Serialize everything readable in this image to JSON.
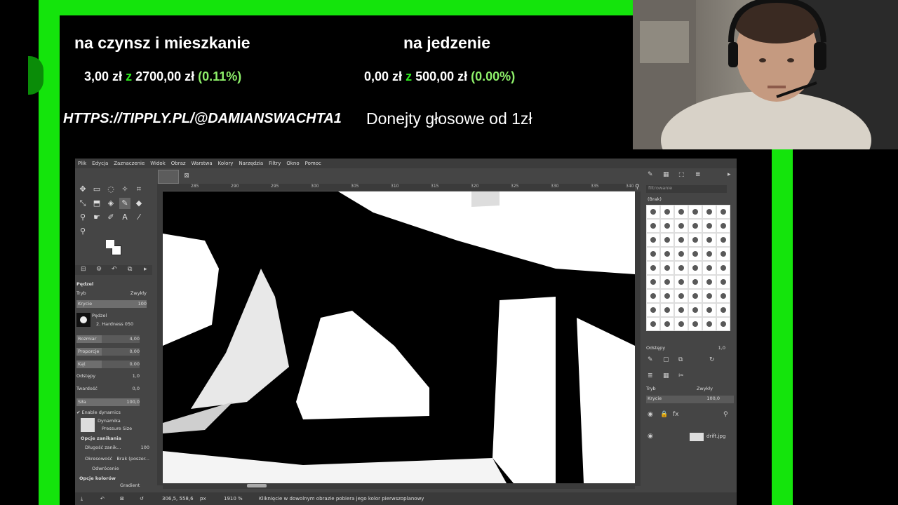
{
  "stream": {
    "goals": [
      {
        "title": "na czynsz i mieszkanie",
        "current": "3,00 zł",
        "sep": "z",
        "target": "2700,00 zł",
        "pct": "(0.11%)"
      },
      {
        "title": "na jedzenie",
        "current": "0,00 zł",
        "sep": "z",
        "target": "500,00 zł",
        "pct": "(0.00%)"
      }
    ],
    "tippy_url": "HTTPS://TIPPLY.PL/@DAMIANSWACHTA1",
    "donate_text": "Donejty głosowe od 1zł",
    "colors": {
      "frame_green": "#14e40c",
      "goal_accent": "#2ee81e",
      "pct_green": "#8ef06a"
    }
  },
  "gimp": {
    "menu": [
      "Plik",
      "Edycja",
      "Zaznaczenie",
      "Widok",
      "Obraz",
      "Warstwa",
      "Kolory",
      "Narzędzia",
      "Filtry",
      "Okno",
      "Pomoc"
    ],
    "ruler_ticks": [
      "285",
      "290",
      "295",
      "300",
      "305",
      "310",
      "315",
      "320",
      "325",
      "330",
      "335",
      "340"
    ],
    "tool_options": {
      "title": "Pędzel",
      "mode_label": "Tryb",
      "mode_value": "Zwykły",
      "opacity_label": "Krycie",
      "opacity_value": "100",
      "brush_label": "Pędzel",
      "brush_value": "2. Hardness 050",
      "size_label": "Rozmiar",
      "size_value": "4,00",
      "aspect_label": "Proporcje",
      "aspect_value": "0,00",
      "angle_label": "Kąt",
      "angle_value": "0,00",
      "spacing_label": "Odstępy",
      "spacing_value": "1,0",
      "hardness_label": "Twardość",
      "hardness_value": "0,0",
      "force_label": "Siła",
      "force_value": "100,0",
      "dynamics_checkbox": "Enable dynamics",
      "dynamics_label": "Dynamika",
      "dynamics_value": "Pressure Size",
      "fade_section": "Opcje zanikania",
      "fade_length_label": "Długość zanik...",
      "fade_length_value": "100",
      "repeat_label": "Okresowość",
      "repeat_value": "Brak (poszer...",
      "reverse_label": "Odwrócenie",
      "color_section": "Opcje kolorów",
      "gradient_label": "Gradient"
    },
    "right_panel": {
      "filter_placeholder": "filtrowanie",
      "brush_set": "(Brak)",
      "spacing_label": "Odstępy",
      "spacing_value": "1,0",
      "layer_mode_label": "Tryb",
      "layer_mode_value": "Zwykły",
      "layer_opacity_label": "Krycie",
      "layer_opacity_value": "100,0",
      "layer_name": "drift.jpg"
    },
    "status": {
      "coords": "306,5, 558,6",
      "unit": "px",
      "zoom": "1910 %",
      "message": "Kliknięcie w dowolnym obrazie pobiera jego kolor pierwszoplanowy"
    }
  }
}
